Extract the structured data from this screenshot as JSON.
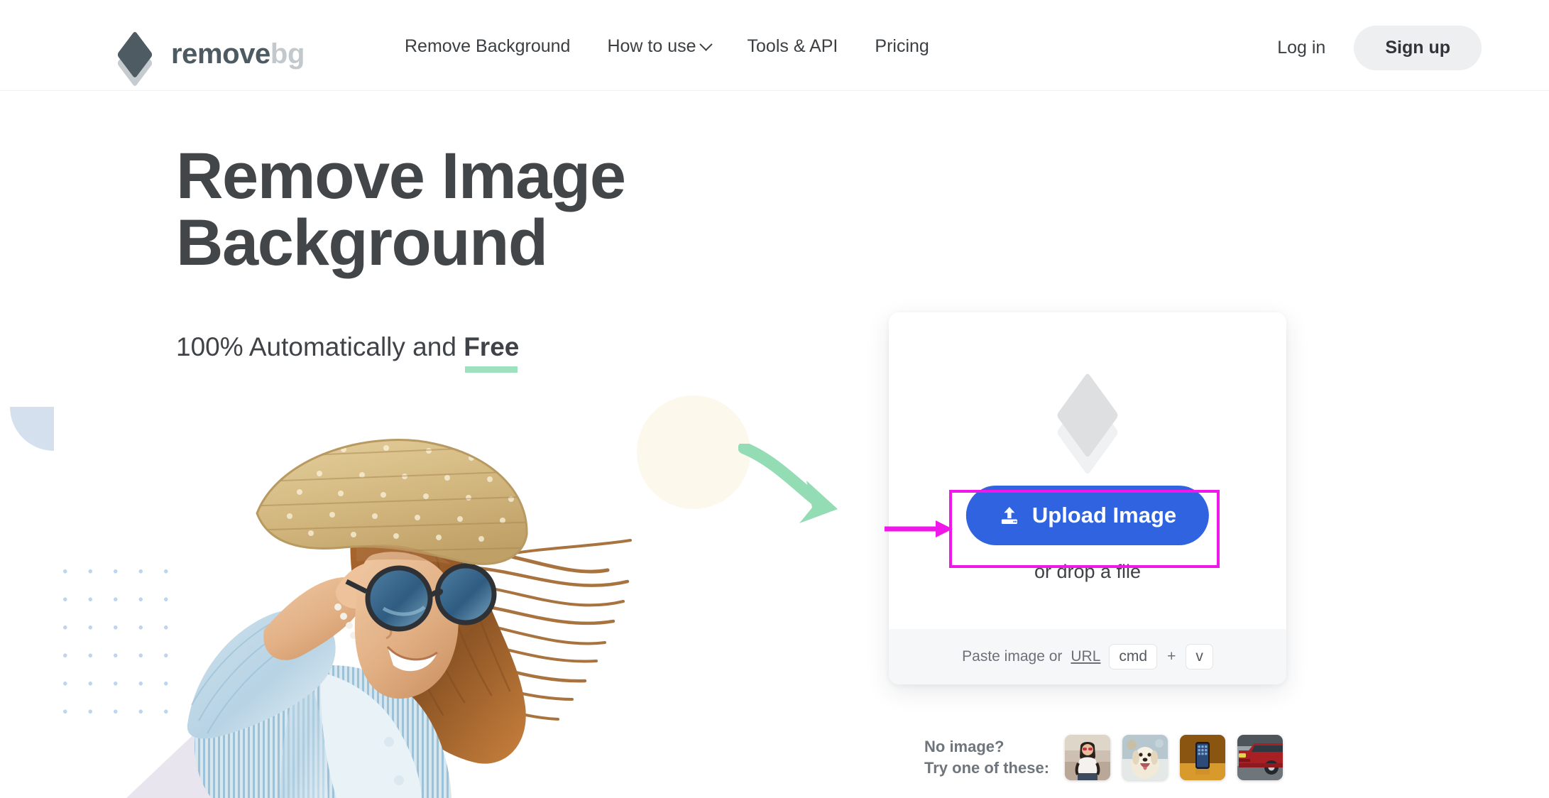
{
  "header": {
    "logo": {
      "primary": "remove",
      "secondary": "bg",
      "icon": "layers-icon"
    },
    "nav": [
      {
        "label": "Remove Background",
        "has_chevron": false
      },
      {
        "label": "How to use",
        "has_chevron": true
      },
      {
        "label": "Tools & API",
        "has_chevron": false
      },
      {
        "label": "Pricing",
        "has_chevron": false
      }
    ],
    "login_label": "Log in",
    "signup_label": "Sign up"
  },
  "hero": {
    "title_line1": "Remove Image",
    "title_line2": "Background",
    "subtitle_prefix": "100% Automatically and ",
    "subtitle_emphasis": "Free",
    "photo_alt": "woman-in-straw-hat-photo"
  },
  "upload": {
    "layers_icon": "layers-icon",
    "button_label": "Upload Image",
    "button_icon": "upload-icon",
    "drop_hint": "or drop a file",
    "paste_text": "Paste image or ",
    "paste_link": "URL",
    "key_primary": "cmd",
    "key_plus": "+",
    "key_secondary": "v"
  },
  "samples": {
    "label_line1": "No image?",
    "label_line2": "Try one of these:",
    "thumbs": [
      {
        "name": "sample-woman"
      },
      {
        "name": "sample-dog"
      },
      {
        "name": "sample-phone"
      },
      {
        "name": "sample-car"
      }
    ]
  },
  "annotation": {
    "highlight_color": "#ef18e8",
    "target": "upload-image-button"
  },
  "colors": {
    "brand_dark": "#4d5a62",
    "brand_light": "#c2c8cc",
    "primary_blue": "#2f63e0",
    "accent_green": "#9fe0be",
    "heading": "#434649",
    "decor_cream": "#fdf8ec",
    "decor_blue": "#d5e0ee",
    "decor_purple": "#e8e5ef"
  }
}
